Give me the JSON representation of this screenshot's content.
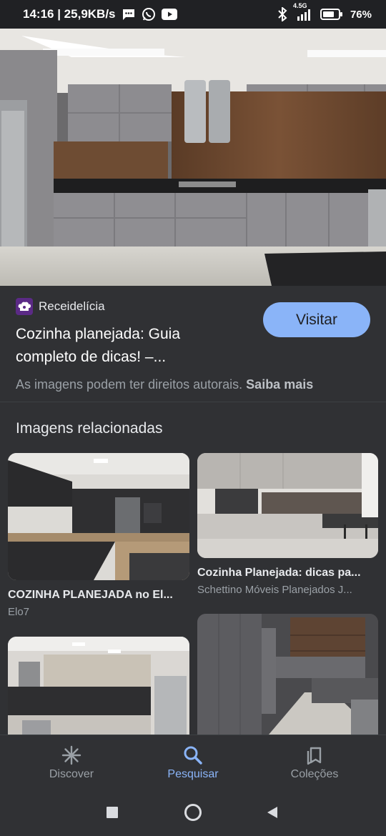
{
  "status_bar": {
    "time_speed": "14:16 | 25,9KB/s",
    "network": "4.5G",
    "battery": "76%"
  },
  "result": {
    "site_name": "Receidelícia",
    "title": "Cozinha planejada: Guia completo de dicas! –...",
    "visit_label": "Visitar",
    "rights_text": "As imagens podem ter direitos autorais.",
    "rights_link": "Saiba mais"
  },
  "related": {
    "heading": "Imagens relacionadas",
    "items": [
      {
        "title": "COZINHA PLANEJADA no El...",
        "source": "Elo7"
      },
      {
        "title": "Cozinha Planejada: dicas pa...",
        "source": "Schettino Móveis Planejados J..."
      }
    ]
  },
  "bottom_nav": [
    {
      "label": "Discover",
      "icon": "asterisk-icon"
    },
    {
      "label": "Pesquisar",
      "icon": "search-icon",
      "active": true
    },
    {
      "label": "Coleções",
      "icon": "collections-icon"
    }
  ],
  "colors": {
    "accent": "#8ab4f8",
    "background": "#303134",
    "status_bar": "#202124"
  }
}
